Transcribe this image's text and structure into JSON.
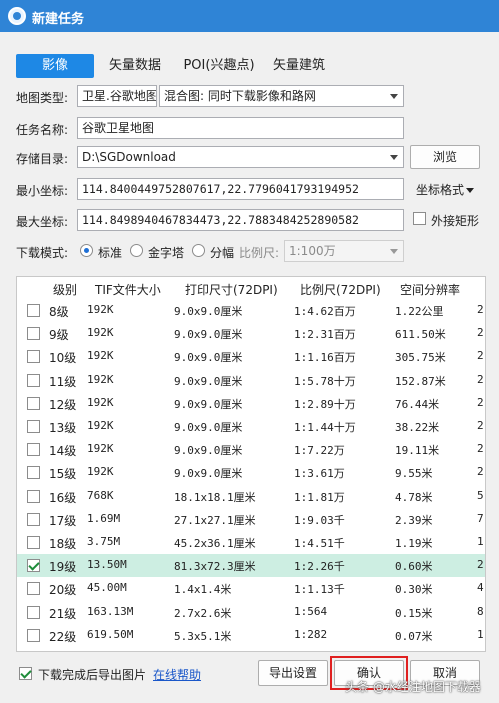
{
  "window": {
    "title": "新建任务"
  },
  "tabs": [
    {
      "label": "影像",
      "active": true
    },
    {
      "label": "矢量数据",
      "active": false
    },
    {
      "label": "POI(兴趣点)",
      "active": false
    },
    {
      "label": "矢量建筑",
      "active": false
    }
  ],
  "form": {
    "map_type_label": "地图类型:",
    "map_source": "卫星.谷歌地图",
    "map_mode": "混合图: 同时下载影像和路网",
    "task_name_label": "任务名称:",
    "task_name": "谷歌卫星地图",
    "storage_label": "存储目录:",
    "storage_path": "D:\\SGDownload",
    "browse": "浏览",
    "min_label": "最小坐标:",
    "min_coord": "114.8400449752807617,22.7796041793194952",
    "coord_format": "坐标格式",
    "max_label": "最大坐标:",
    "max_coord": "114.8498940467834473,22.7883484252890582",
    "bounding_rect": "外接矩形",
    "mode_label": "下载模式:",
    "mode_standard": "标准",
    "mode_pyramid": "金字塔",
    "mode_tiled": "分幅",
    "scale_label": "比例尺:",
    "scale_value": "1:100万"
  },
  "table": {
    "headers": [
      "级别",
      "TIF文件大小",
      "打印尺寸(72DPI)",
      "比例尺(72DPI)",
      "空间分辨率"
    ],
    "rows": [
      {
        "level": "8级",
        "size": "192K",
        "print": "9.0x9.0厘米",
        "scale": "1:4.62百万",
        "res": "1.22公里",
        "trail": "2",
        "checked": false,
        "selected": false
      },
      {
        "level": "9级",
        "size": "192K",
        "print": "9.0x9.0厘米",
        "scale": "1:2.31百万",
        "res": "611.50米",
        "trail": "2",
        "checked": false,
        "selected": false
      },
      {
        "level": "10级",
        "size": "192K",
        "print": "9.0x9.0厘米",
        "scale": "1:1.16百万",
        "res": "305.75米",
        "trail": "2",
        "checked": false,
        "selected": false
      },
      {
        "level": "11级",
        "size": "192K",
        "print": "9.0x9.0厘米",
        "scale": "1:5.78十万",
        "res": "152.87米",
        "trail": "2",
        "checked": false,
        "selected": false
      },
      {
        "level": "12级",
        "size": "192K",
        "print": "9.0x9.0厘米",
        "scale": "1:2.89十万",
        "res": "76.44米",
        "trail": "2",
        "checked": false,
        "selected": false
      },
      {
        "level": "13级",
        "size": "192K",
        "print": "9.0x9.0厘米",
        "scale": "1:1.44十万",
        "res": "38.22米",
        "trail": "2",
        "checked": false,
        "selected": false
      },
      {
        "level": "14级",
        "size": "192K",
        "print": "9.0x9.0厘米",
        "scale": "1:7.22万",
        "res": "19.11米",
        "trail": "2",
        "checked": false,
        "selected": false
      },
      {
        "level": "15级",
        "size": "192K",
        "print": "9.0x9.0厘米",
        "scale": "1:3.61万",
        "res": "9.55米",
        "trail": "2",
        "checked": false,
        "selected": false
      },
      {
        "level": "16级",
        "size": "768K",
        "print": "18.1x18.1厘米",
        "scale": "1:1.81万",
        "res": "4.78米",
        "trail": "5",
        "checked": false,
        "selected": false
      },
      {
        "level": "17级",
        "size": "1.69M",
        "print": "27.1x27.1厘米",
        "scale": "1:9.03千",
        "res": "2.39米",
        "trail": "7",
        "checked": false,
        "selected": false
      },
      {
        "level": "18级",
        "size": "3.75M",
        "print": "45.2x36.1厘米",
        "scale": "1:4.51千",
        "res": "1.19米",
        "trail": "1",
        "checked": false,
        "selected": false
      },
      {
        "level": "19级",
        "size": "13.50M",
        "print": "81.3x72.3厘米",
        "scale": "1:2.26千",
        "res": "0.60米",
        "trail": "2",
        "checked": true,
        "selected": true
      },
      {
        "level": "20级",
        "size": "45.00M",
        "print": "1.4x1.4米",
        "scale": "1:1.13千",
        "res": "0.30米",
        "trail": "4",
        "checked": false,
        "selected": false
      },
      {
        "level": "21级",
        "size": "163.13M",
        "print": "2.7x2.6米",
        "scale": "1:564",
        "res": "0.15米",
        "trail": "8",
        "checked": false,
        "selected": false
      },
      {
        "level": "22级",
        "size": "619.50M",
        "print": "5.3x5.1米",
        "scale": "1:282",
        "res": "0.07米",
        "trail": "1",
        "checked": false,
        "selected": false
      }
    ]
  },
  "footer": {
    "export_after_download": "下载完成后导出图片",
    "export_checked": true,
    "online_help": "在线帮助",
    "export_settings": "导出设置",
    "confirm": "确认",
    "cancel": "取消",
    "watermark": "头条 @水经注地图下载器"
  }
}
